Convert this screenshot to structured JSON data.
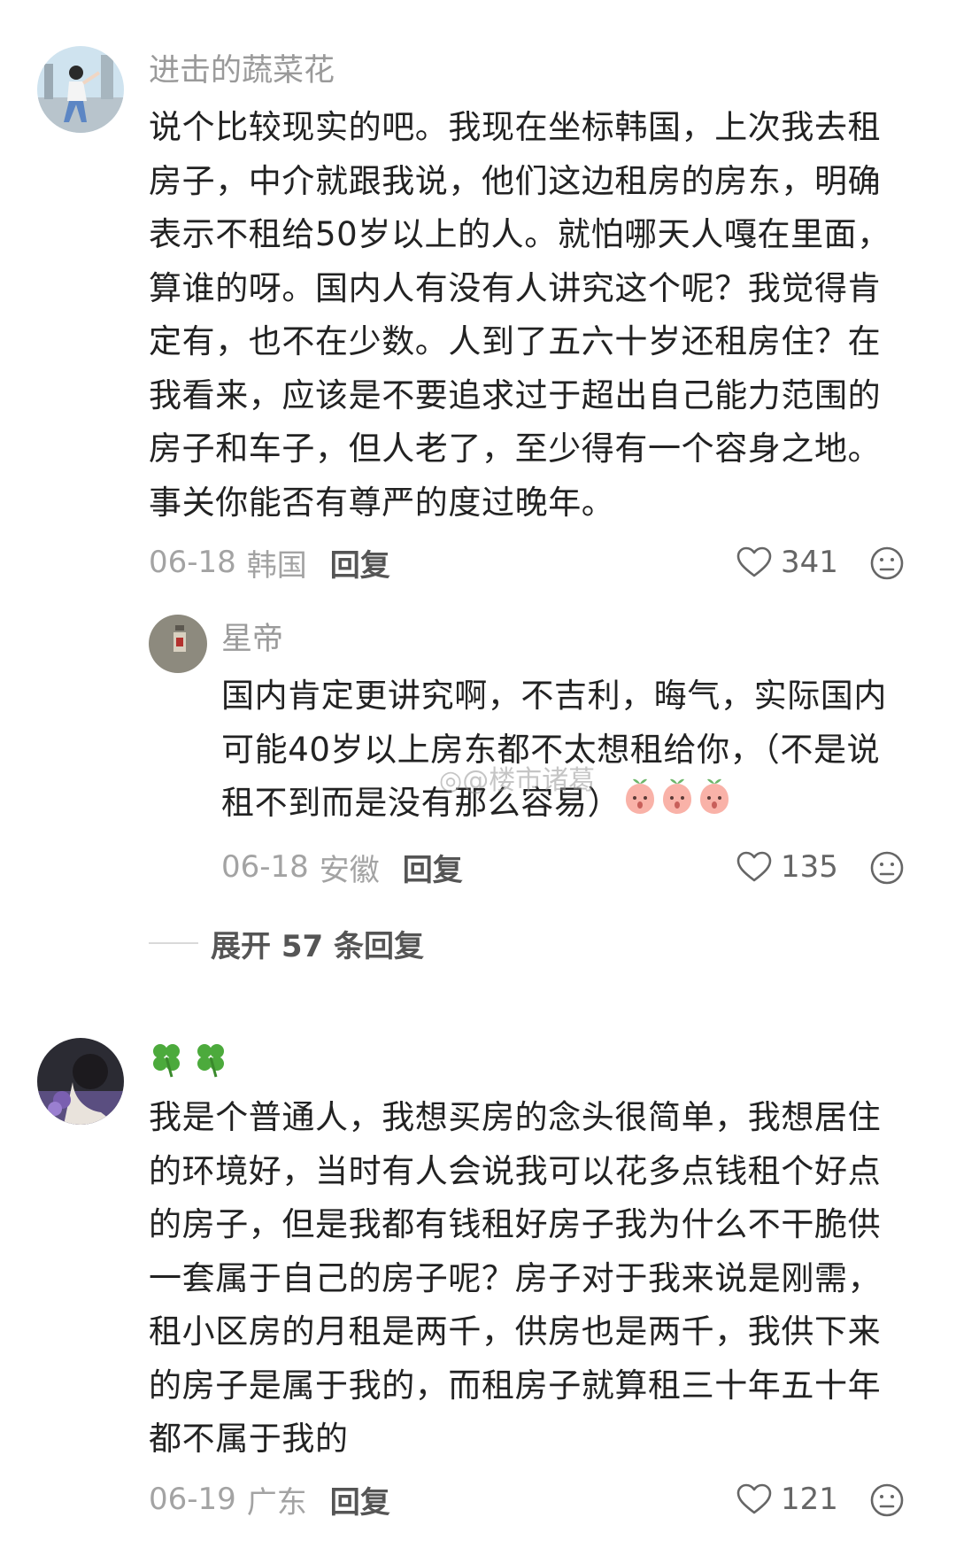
{
  "comments": [
    {
      "username": "进击的蔬菜花",
      "content_lines": [
        "说个比较现实的吧。我现在坐标韩国，上次我去租",
        "房子，中介就跟我说，他们这边租房的房东，明确",
        "表示不租给50岁以上的人。就怕哪天人嘎在里面，",
        "算谁的呀。国内人有没有人讲究这个呢？我觉得肯",
        "定有，也不在少数。人到了五六十岁还租房住？在",
        "我看来，应该是不要追求过于超出自己能力范围的",
        "房子和车子，但人老了，至少得有一个容身之地。",
        "事关你能否有尊严的度过晚年。"
      ],
      "date": "06-18",
      "location": "韩国",
      "reply_label": "回复",
      "likes": "341"
    },
    {
      "username": "",
      "content_lines": [
        "我是个普通人，我想买房的念头很简单，我想居住",
        "的环境好，当时有人会说我可以花多点钱租个好点",
        "的房子，但是我都有钱租好房子我为什么不干脆供",
        "一套属于自己的房子呢？房子对于我来说是刚需，",
        "租小区房的月租是两千，供房也是两千，我供下来",
        "的房子是属于我的，而租房子就算租三十年五十年",
        "都不属于我的"
      ],
      "date": "06-19",
      "location": "广东",
      "reply_label": "回复",
      "likes": "121"
    }
  ],
  "reply": {
    "username": "星帝",
    "content_lines": [
      "国内肯定更讲究啊，不吉利，晦气，实际国内",
      "可能40岁以上房东都不太想租给你，（不是说",
      "租不到而是没有那么容易）"
    ],
    "date": "06-18",
    "location": "安徽",
    "reply_label": "回复",
    "likes": "135"
  },
  "expand_label": "展开 57 条回复",
  "watermark": "@楼市诸葛",
  "icons": {
    "like": "heart-outline-icon",
    "dislike": "frown-face-icon",
    "emoji": "peach-face-emoji",
    "name_emoji": "four-leaf-clover"
  },
  "colors": {
    "username": "#9a9a9a",
    "text": "#222222",
    "meta": "#a3a3a3",
    "reply_button": "#555555"
  }
}
